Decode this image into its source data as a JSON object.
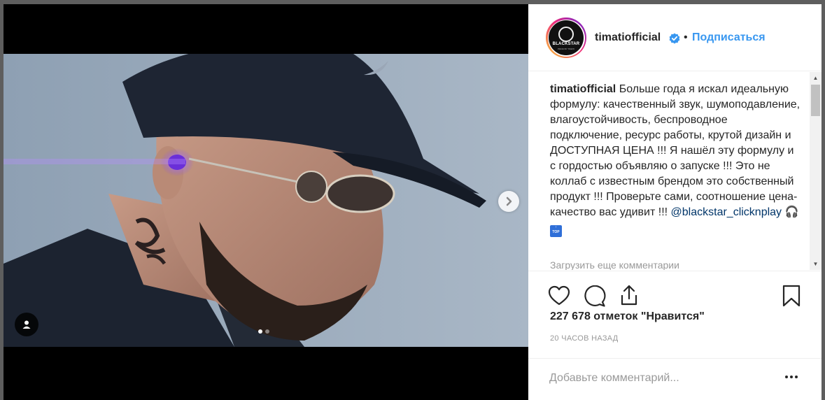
{
  "post": {
    "username": "timatiofficial",
    "follow_label": "Подписаться",
    "bullet": "•",
    "avatar": {
      "logo_text": "BLACKSTAR",
      "sub_text": "PROD BY TIMATI"
    },
    "caption": {
      "user": "timatiofficial",
      "text": "Больше года я искал идеальную формулу: качественный звук, шумоподавление, влагоустойчивость, беспроводное подключение, ресурс работы, крутой дизайн и ДОСТУПНАЯ ЦЕНА !!! Я нашёл эту формулу и с гордостью объявляю о запуске !!! Это не коллаб с известным брендом это собственный продукт !!! Проверьте сами, соотношение цена-качество вас удивит !!!",
      "mention": "@blackstar_clicknplay",
      "emoji_headphones": "🎧",
      "emoji_top_label": "TOP"
    },
    "load_more_comments": "Загрузить еще комментарии",
    "likes": "227 678 отметок \"Нравится\"",
    "timestamp": "20 ЧАСОВ НАЗАД",
    "comment_placeholder": "Добавьте комментарий...",
    "carousel": {
      "current": 1,
      "total": 2
    }
  },
  "icons": {
    "verified": "verified-badge-icon",
    "next": "chevron-right-icon",
    "user_tag": "user-icon",
    "like": "heart-icon",
    "comment": "comment-icon",
    "share": "share-icon",
    "save": "bookmark-icon",
    "more": "more-options-icon"
  },
  "colors": {
    "link_blue": "#3897f0",
    "mention": "#003569",
    "text": "#262626",
    "muted": "#999999"
  }
}
